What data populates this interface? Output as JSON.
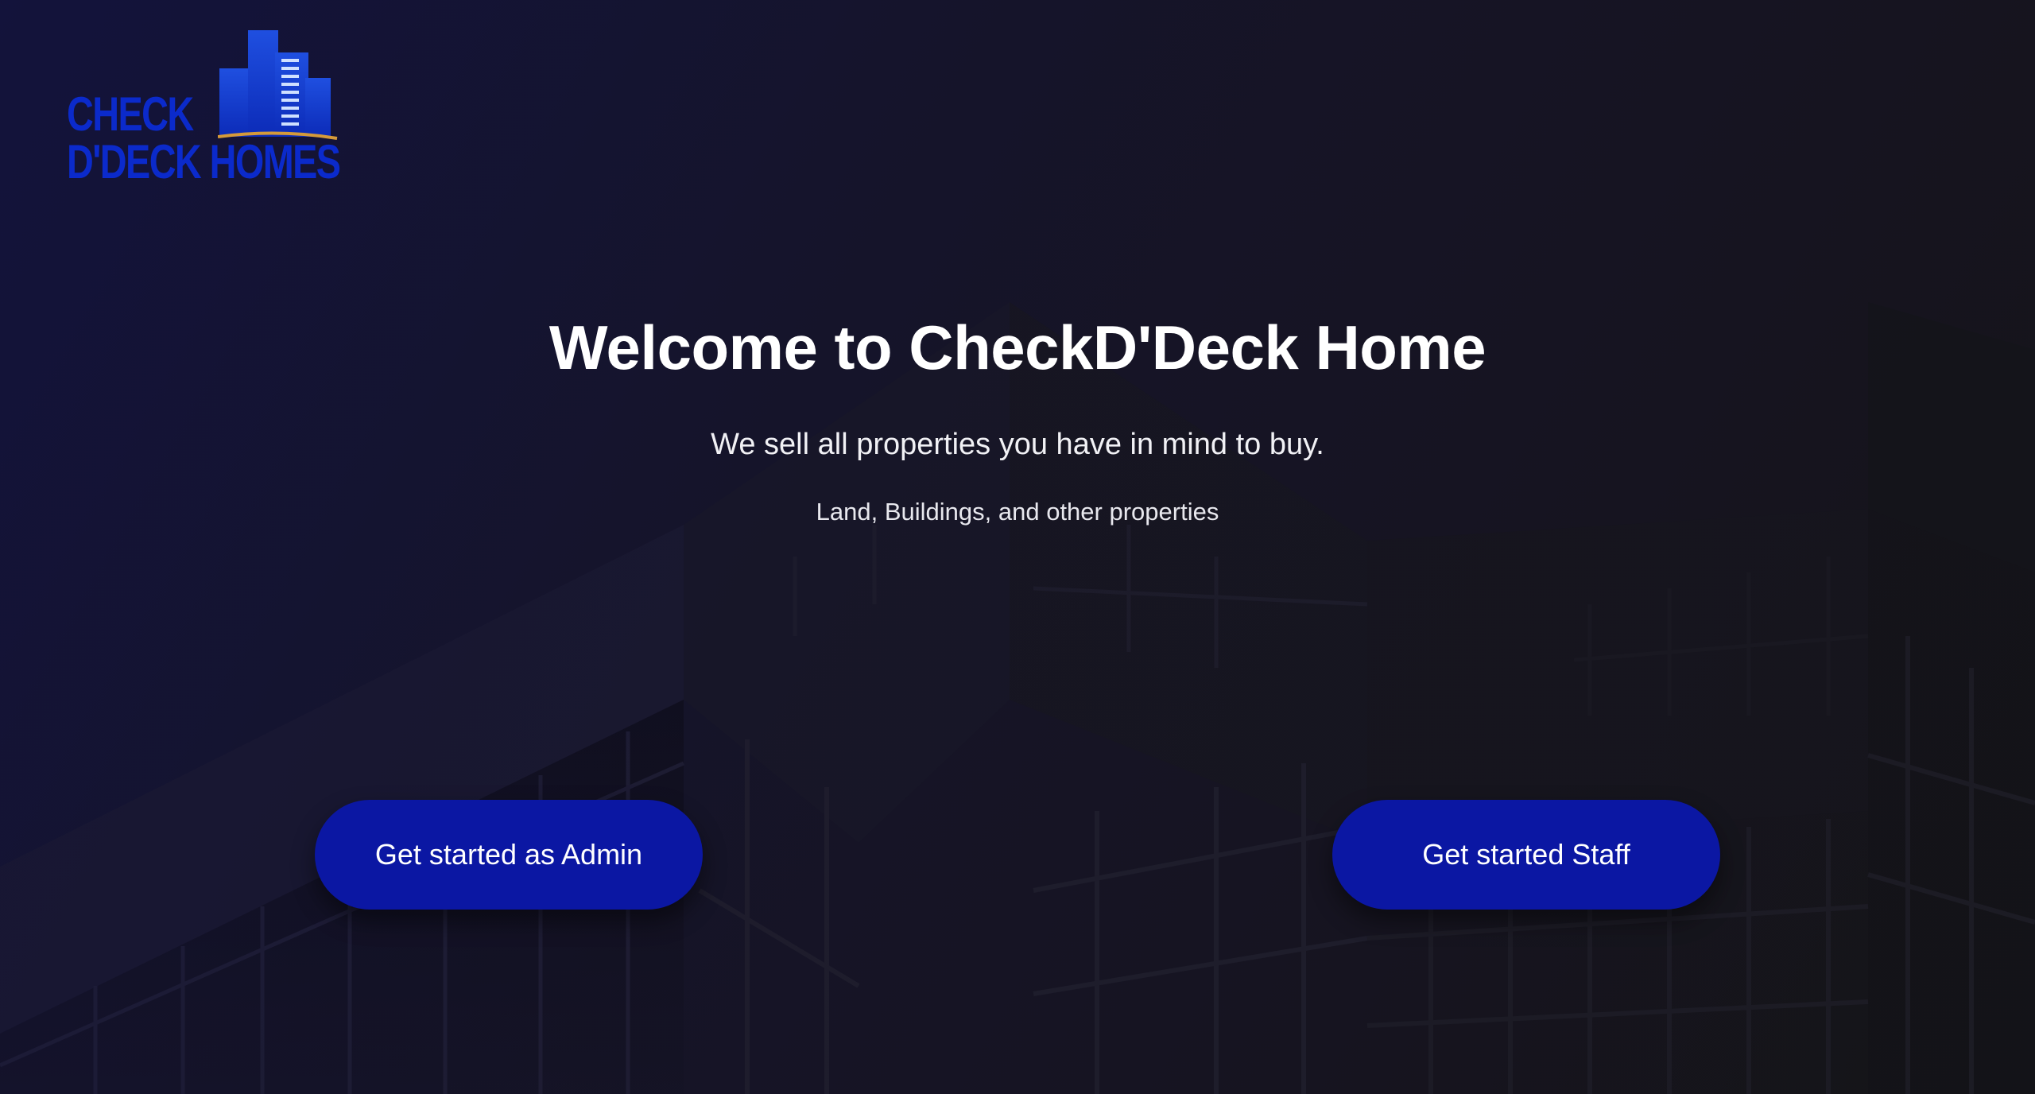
{
  "brand": {
    "logo_line1": "CHECK",
    "logo_line2": "D'DECK HOMES",
    "logo_color": "#0b2acb"
  },
  "hero": {
    "title": "Welcome to CheckD'Deck Home",
    "subtitle": "We sell all properties you have in mind to buy.",
    "tagline": "Land, Buildings, and other properties"
  },
  "actions": {
    "admin_label": "Get started as Admin",
    "staff_label": "Get started Staff",
    "button_color": "#0b17a3"
  },
  "icons": {
    "logo": "building-skyline-icon"
  }
}
